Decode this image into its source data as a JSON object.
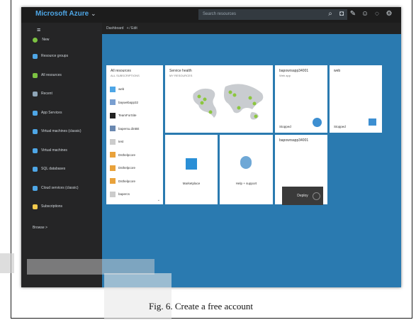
{
  "app": {
    "brand": "Microsoft Azure",
    "chevron": "⌄",
    "search_placeholder": "Search resources",
    "topbar_icons": [
      "search-icon",
      "bell-icon",
      "edit-icon",
      "smile-icon",
      "help-icon",
      "settings-icon"
    ]
  },
  "sidebar": {
    "menu_icon": "≡",
    "new_label": "New",
    "items": [
      {
        "label": "Resource groups",
        "color": "#4ea6e6"
      },
      {
        "label": "All resources",
        "color": "#7cc242"
      },
      {
        "label": "Recent",
        "color": "#8fa6b8"
      },
      {
        "label": "App Services",
        "color": "#4ea6e6"
      },
      {
        "label": "Virtual machines (classic)",
        "color": "#4ea6e6"
      },
      {
        "label": "Virtual machines",
        "color": "#4ea6e6"
      },
      {
        "label": "SQL databases",
        "color": "#4ea6e6"
      },
      {
        "label": "Cloud services (classic)",
        "color": "#4ea6e6"
      },
      {
        "label": "Subscriptions",
        "color": "#f2c94c"
      }
    ],
    "browse_label": "Browse >"
  },
  "dashboard": {
    "title": "Dashboard",
    "actions": "+ ⁄ Edit"
  },
  "tiles": {
    "all_resources": {
      "title": "All resources",
      "subtitle": "ALL SUBSCRIPTIONS",
      "rows": [
        {
          "label": "web",
          "color": "#4ea6e6"
        },
        {
          "label": "baywebapp32",
          "color": "#7a9fd0"
        },
        {
          "label": "TeamForSite",
          "color": "#222222"
        },
        {
          "label": "bapersu.dinBE",
          "color": "#6a88b0"
        },
        {
          "label": "test",
          "color": "#cccccc"
        },
        {
          "label": "Dsthelpcore",
          "color": "#e9a23b"
        },
        {
          "label": "Dsthelpcore",
          "color": "#e9a23b"
        },
        {
          "label": "Dsthelpcore",
          "color": "#e9a23b"
        },
        {
          "label": "bapercs",
          "color": "#cccccc"
        }
      ]
    },
    "service_health": {
      "title": "Service health",
      "subtitle": "MY RESOURCES"
    },
    "app1": {
      "title": "bapowrsapp34001",
      "subtitle": "Web app",
      "status": "Stopped"
    },
    "web": {
      "title": "web",
      "status": "Stopped"
    },
    "marketplace": {
      "label": "Marketplace"
    },
    "help": {
      "label": "Help + support"
    },
    "deploy": {
      "title": "bapowrsapp34001",
      "button": "Deploy"
    }
  },
  "caption": "Fig. 6.   Create a free account"
}
